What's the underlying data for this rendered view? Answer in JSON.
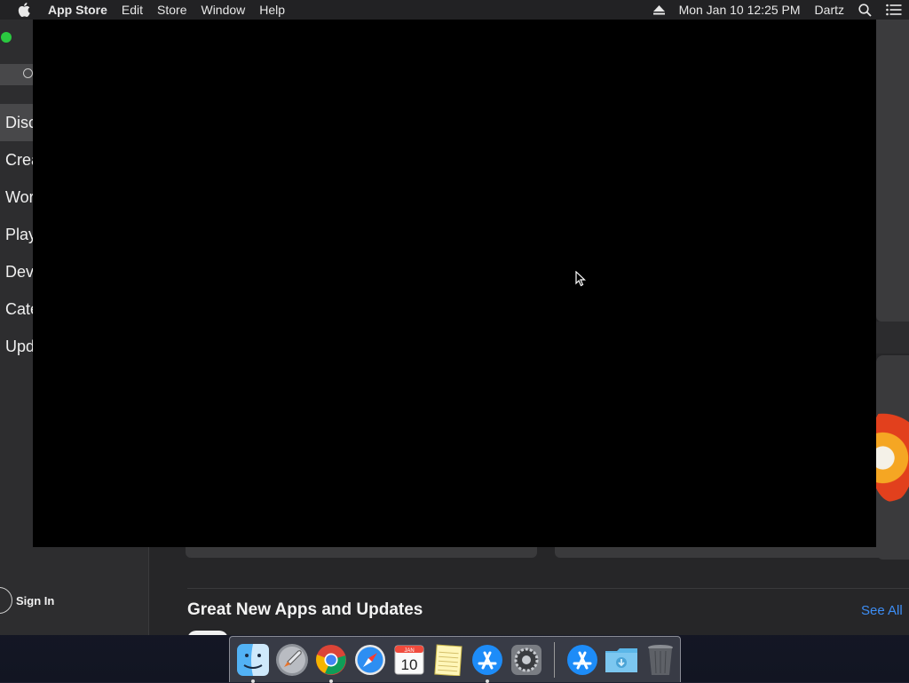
{
  "menubar": {
    "app_name": "App Store",
    "menus": [
      "Edit",
      "Store",
      "Window",
      "Help"
    ],
    "clock": "Mon Jan 10  12:25 PM",
    "user": "Dartz"
  },
  "sidebar": {
    "items": [
      {
        "label": "Discover",
        "selected": true
      },
      {
        "label": "Create",
        "selected": false
      },
      {
        "label": "Work",
        "selected": false
      },
      {
        "label": "Play",
        "selected": false
      },
      {
        "label": "Develop",
        "selected": false
      },
      {
        "label": "Categories",
        "selected": false
      },
      {
        "label": "Updates",
        "selected": false
      }
    ],
    "sign_in": "Sign In"
  },
  "main": {
    "section_title": "Great New Apps and Updates",
    "see_all": "See All"
  },
  "dock": {
    "calendar_month": "JAN",
    "calendar_day": "10",
    "items": [
      "finder-icon",
      "launchpad-icon",
      "chrome-icon",
      "safari-icon",
      "calendar-icon",
      "notes-icon",
      "app-store-icon",
      "system-preferences-icon",
      "app-store-icon",
      "downloads-folder-icon",
      "trash-icon"
    ]
  },
  "colors": {
    "accent": "#3d8ef5",
    "menubar": "#222224",
    "sidebar": "#2d2d2f",
    "selected": "#48484a"
  }
}
